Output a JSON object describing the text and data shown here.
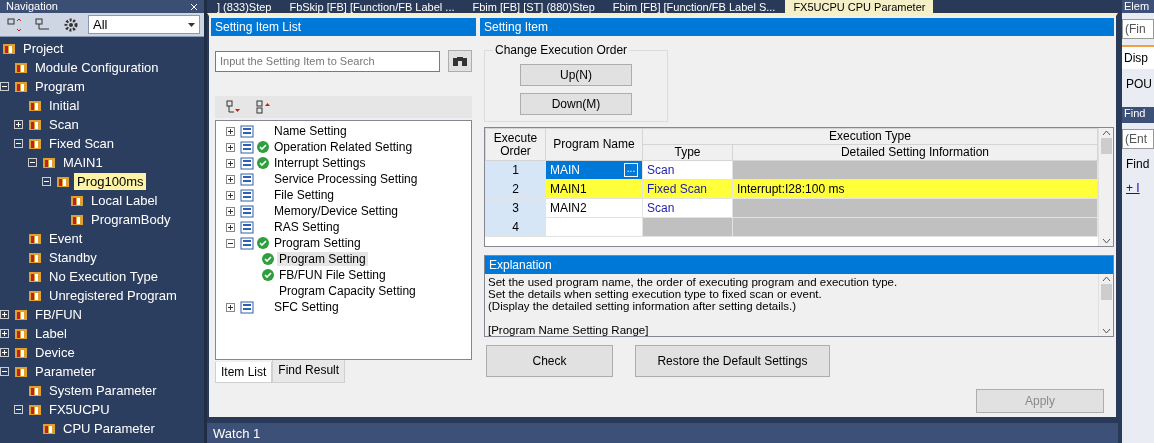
{
  "navigation": {
    "title": "Navigation",
    "filter": "All",
    "tree": [
      {
        "label": "Project",
        "children": [
          {
            "label": "Module Configuration"
          },
          {
            "label": "Program",
            "expanded": true,
            "children": [
              {
                "label": "Initial"
              },
              {
                "label": "Scan",
                "expanded": false
              },
              {
                "label": "Fixed Scan",
                "expanded": true,
                "children": [
                  {
                    "label": "MAIN1",
                    "expanded": true,
                    "children": [
                      {
                        "label": "Prog100ms",
                        "expanded": true,
                        "selected": true,
                        "children": [
                          {
                            "label": "Local Label",
                            "selected": false
                          },
                          {
                            "label": "ProgramBody",
                            "selected": false
                          }
                        ]
                      }
                    ]
                  }
                ]
              },
              {
                "label": "Event"
              },
              {
                "label": "Standby"
              },
              {
                "label": "No Execution Type"
              },
              {
                "label": "Unregistered Program"
              }
            ]
          },
          {
            "label": "FB/FUN",
            "expanded": false
          },
          {
            "label": "Label",
            "expanded": false
          },
          {
            "label": "Device",
            "expanded": false
          },
          {
            "label": "Parameter",
            "expanded": true,
            "children": [
              {
                "label": "System Parameter"
              },
              {
                "label": "FX5UCPU",
                "expanded": true,
                "children": [
                  {
                    "label": "CPU Parameter"
                  }
                ]
              }
            ]
          }
        ]
      }
    ]
  },
  "top_tabs": [
    {
      "label": "] (833)Step",
      "selected": false
    },
    {
      "label": "FbSkip [FB] [Function/FB Label ...",
      "selected": false
    },
    {
      "label": "Fbim [FB] [ST] (880)Step",
      "selected": false
    },
    {
      "label": "Fbim [FB] [Function/FB Label S...",
      "selected": false
    },
    {
      "label": "FX5UCPU CPU Parameter",
      "selected": true
    }
  ],
  "setting_item_list": {
    "title": "Setting Item List",
    "search_placeholder": "Input the Setting Item to Search",
    "tree": [
      {
        "label": "Name Setting",
        "configured": false,
        "expanded": false
      },
      {
        "label": "Operation Related Setting",
        "configured": true,
        "expanded": false
      },
      {
        "label": "Interrupt Settings",
        "configured": true,
        "expanded": false
      },
      {
        "label": "Service Processing Setting",
        "configured": false,
        "expanded": false
      },
      {
        "label": "File Setting",
        "configured": false,
        "expanded": false
      },
      {
        "label": "Memory/Device Setting",
        "configured": false,
        "expanded": false
      },
      {
        "label": "RAS Setting",
        "configured": false,
        "expanded": false
      },
      {
        "label": "Program Setting",
        "configured": true,
        "expanded": true,
        "children": [
          {
            "label": "Program Setting",
            "configured": true,
            "selected": true
          },
          {
            "label": "FB/FUN File Setting",
            "configured": true,
            "selected": false
          },
          {
            "label": "Program Capacity Setting",
            "configured": false,
            "selected": false
          }
        ]
      },
      {
        "label": "SFC Setting",
        "configured": false,
        "expanded": false
      }
    ],
    "bottom_tabs": [
      {
        "label": "Item List",
        "selected": true
      },
      {
        "label": "Find Result",
        "selected": false
      }
    ]
  },
  "setting_item": {
    "title": "Setting Item",
    "group_title": "Change Execution Order",
    "order_buttons": [
      "Up(N)",
      "Down(M)"
    ],
    "table": {
      "headers": {
        "order": "Execute Order",
        "name": "Program Name",
        "execution_type": "Execution Type",
        "type": "Type",
        "detail": "Detailed Setting Information"
      },
      "rows": [
        {
          "order": "1",
          "name": "MAIN",
          "button": "...",
          "type": "Scan",
          "selected": true,
          "highlighted": false
        },
        {
          "order": "2",
          "name": "MAIN1",
          "type": "Fixed Scan",
          "detail": "Interrupt:I28:100 ms",
          "selected": false,
          "highlighted": true
        },
        {
          "order": "3",
          "name": "MAIN2",
          "type": "Scan",
          "selected": false,
          "highlighted": false
        },
        {
          "order": "4",
          "selected": false,
          "highlighted": false
        }
      ]
    }
  },
  "explanation": {
    "title": "Explanation",
    "paragraphs": [
      [
        "Set the used program name, the order of executing program and execution type.",
        "Set the details when setting execution type to fixed scan or event.",
        "(Display the detailed setting information after setting details.)"
      ],
      [
        "[Program Name Setting Range]"
      ]
    ]
  },
  "actions": [
    "Check",
    "Restore the Default Settings"
  ],
  "apply": {
    "label": "Apply",
    "disabled": true
  },
  "watch": {
    "title": "Watch 1"
  },
  "side_panel": {
    "title": "Elem",
    "search_placeholder": "(Fin",
    "tab": "Disp",
    "footer": "POU",
    "find_title": "Find",
    "find_placeholder": "(Ent",
    "find_label": "Find",
    "link": "+ I"
  }
}
